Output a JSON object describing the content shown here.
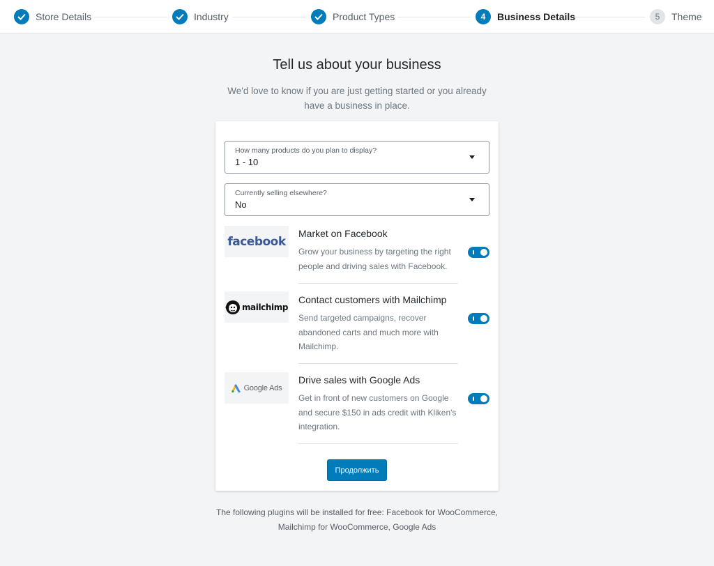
{
  "stepper": {
    "steps": [
      {
        "label": "Store Details",
        "state": "done"
      },
      {
        "label": "Industry",
        "state": "done"
      },
      {
        "label": "Product Types",
        "state": "done"
      },
      {
        "label": "Business Details",
        "state": "current",
        "number": "4"
      },
      {
        "label": "Theme",
        "state": "pending",
        "number": "5"
      }
    ]
  },
  "heading": {
    "title": "Tell us about your business",
    "subtitle": "We'd love to know if you are just getting started or you already have a business in place."
  },
  "form": {
    "products_select": {
      "label": "How many products do you plan to display?",
      "value": "1 - 10"
    },
    "selling_select": {
      "label": "Currently selling elsewhere?",
      "value": "No"
    }
  },
  "extensions": [
    {
      "logo": "facebook",
      "title": "Market on Facebook",
      "description": "Grow your business by targeting the right people and driving sales with Facebook.",
      "enabled": true
    },
    {
      "logo": "mailchimp",
      "title": "Contact customers with Mailchimp",
      "description": "Send targeted campaigns, recover abandoned carts and much more with Mailchimp.",
      "enabled": true
    },
    {
      "logo": "Google Ads",
      "title": "Drive sales with Google Ads",
      "description": "Get in front of new customers on Google and secure $150 in ads credit with Kliken's integration.",
      "enabled": true
    }
  ],
  "continue_label": "Продолжить",
  "footer_note": "The following plugins will be installed for free: Facebook for WooCommerce, Mailchimp for WooCommerce, Google Ads",
  "colors": {
    "accent": "#007cba",
    "background": "#f3f4f5",
    "facebook_brand": "#3b5998"
  }
}
